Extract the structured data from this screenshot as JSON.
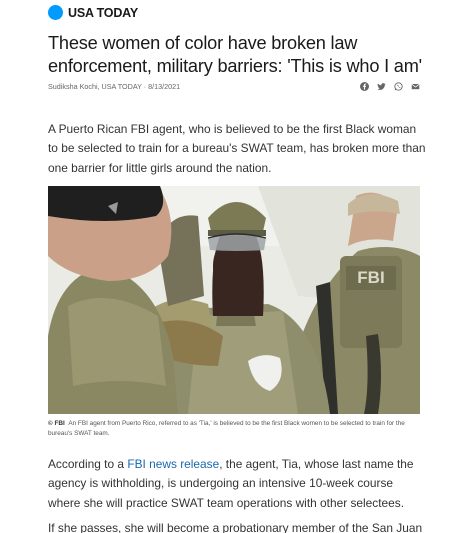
{
  "masthead": {
    "brand": "USA TODAY",
    "accent": "#009bff"
  },
  "article": {
    "headline": "These women of color have broken law enforcement, military barriers: 'This is who I am'",
    "byline": "Sudiksha Kochi, USA TODAY · 8/13/2021",
    "share_icons": [
      "facebook-icon",
      "twitter-icon",
      "whatsapp-icon",
      "email-icon"
    ],
    "lede": "A Puerto Rican FBI agent, who is believed to be the first Black woman to be selected to train for a bureau's SWAT team, has broken more than one barrier for little girls around the nation.",
    "photo": {
      "patch_text": "FBI",
      "credit": "© FBI",
      "caption": "An FBI agent from Puerto Rico, referred to as 'Tia,' is believed to be the first Black women to be selected to train for the bureau's SWAT team."
    },
    "para2_before": "According to a ",
    "para2_link": "FBI news release",
    "para2_after": ", the agent, Tia, whose last name the agency is withholding, is undergoing an intensive 10-week course where she will practice SWAT team operations with other selectees.",
    "para3_partial": "If she passes, she will become a probationary member of the San Juan"
  }
}
